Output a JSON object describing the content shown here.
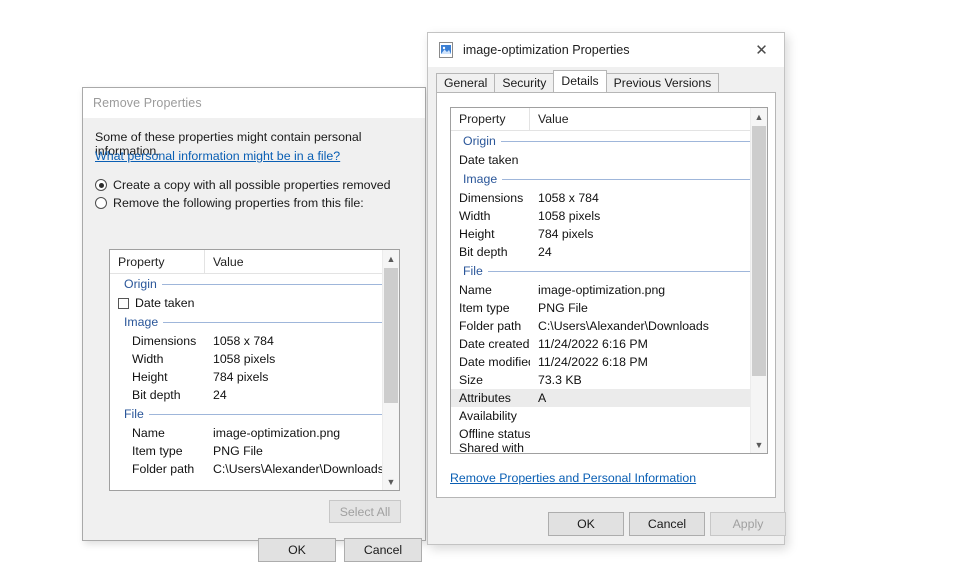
{
  "remove_properties_dialog": {
    "title": "Remove Properties",
    "intro_text": "Some of these properties might contain personal information.",
    "help_link": "What personal information might be in a file?",
    "option_create_copy": "Create a copy with all possible properties removed",
    "option_remove_following": "Remove the following properties from this file:",
    "selected_option": "create_copy",
    "list": {
      "columns": [
        "Property",
        "Value"
      ],
      "rows": [
        {
          "kind": "group",
          "label": "Origin"
        },
        {
          "kind": "item",
          "checkbox": true,
          "checked": false,
          "property": "Date taken",
          "value": ""
        },
        {
          "kind": "group",
          "label": "Image"
        },
        {
          "kind": "item",
          "property": "Dimensions",
          "value": "1058 x 784"
        },
        {
          "kind": "item",
          "property": "Width",
          "value": "1058 pixels"
        },
        {
          "kind": "item",
          "property": "Height",
          "value": "784 pixels"
        },
        {
          "kind": "item",
          "property": "Bit depth",
          "value": "24"
        },
        {
          "kind": "group",
          "label": "File"
        },
        {
          "kind": "item",
          "property": "Name",
          "value": "image-optimization.png"
        },
        {
          "kind": "item",
          "property": "Item type",
          "value": "PNG File"
        },
        {
          "kind": "item",
          "property": "Folder path",
          "value": "C:\\Users\\Alexander\\Downloads"
        }
      ]
    },
    "select_all_button": "Select All",
    "select_all_disabled": true,
    "ok_button": "OK",
    "cancel_button": "Cancel"
  },
  "properties_window": {
    "title": "image-optimization Properties",
    "close_icon": "✕",
    "tabs": [
      {
        "label": "General",
        "active": false
      },
      {
        "label": "Security",
        "active": false
      },
      {
        "label": "Details",
        "active": true
      },
      {
        "label": "Previous Versions",
        "active": false
      }
    ],
    "list": {
      "columns": [
        "Property",
        "Value"
      ],
      "rows": [
        {
          "kind": "group",
          "label": "Origin"
        },
        {
          "kind": "item",
          "property": "Date taken",
          "value": ""
        },
        {
          "kind": "group",
          "label": "Image"
        },
        {
          "kind": "item",
          "property": "Dimensions",
          "value": "1058 x 784"
        },
        {
          "kind": "item",
          "property": "Width",
          "value": "1058 pixels"
        },
        {
          "kind": "item",
          "property": "Height",
          "value": "784 pixels"
        },
        {
          "kind": "item",
          "property": "Bit depth",
          "value": "24"
        },
        {
          "kind": "group",
          "label": "File"
        },
        {
          "kind": "item",
          "property": "Name",
          "value": "image-optimization.png"
        },
        {
          "kind": "item",
          "property": "Item type",
          "value": "PNG File"
        },
        {
          "kind": "item",
          "property": "Folder path",
          "value": "C:\\Users\\Alexander\\Downloads"
        },
        {
          "kind": "item",
          "property": "Date created",
          "value": "11/24/2022 6:16 PM"
        },
        {
          "kind": "item",
          "property": "Date modified",
          "value": "11/24/2022 6:18 PM"
        },
        {
          "kind": "item",
          "property": "Size",
          "value": "73.3 KB"
        },
        {
          "kind": "item",
          "property": "Attributes",
          "value": "A",
          "highlight": true
        },
        {
          "kind": "item",
          "property": "Availability",
          "value": ""
        },
        {
          "kind": "item",
          "property": "Offline status",
          "value": ""
        },
        {
          "kind": "item",
          "property": "Shared with",
          "value": "",
          "clipped": true
        }
      ]
    },
    "remove_link": "Remove Properties and Personal Information",
    "ok_button": "OK",
    "cancel_button": "Cancel",
    "apply_button": "Apply",
    "apply_disabled": true
  },
  "colors": {
    "link": "#0a5fb4",
    "group_label": "#2a5699",
    "window_bg": "#f0f0f0",
    "listbox_bg": "#ffffff",
    "row_highlight": "#ebebeb",
    "scroll_thumb": "#cdcdcd"
  }
}
